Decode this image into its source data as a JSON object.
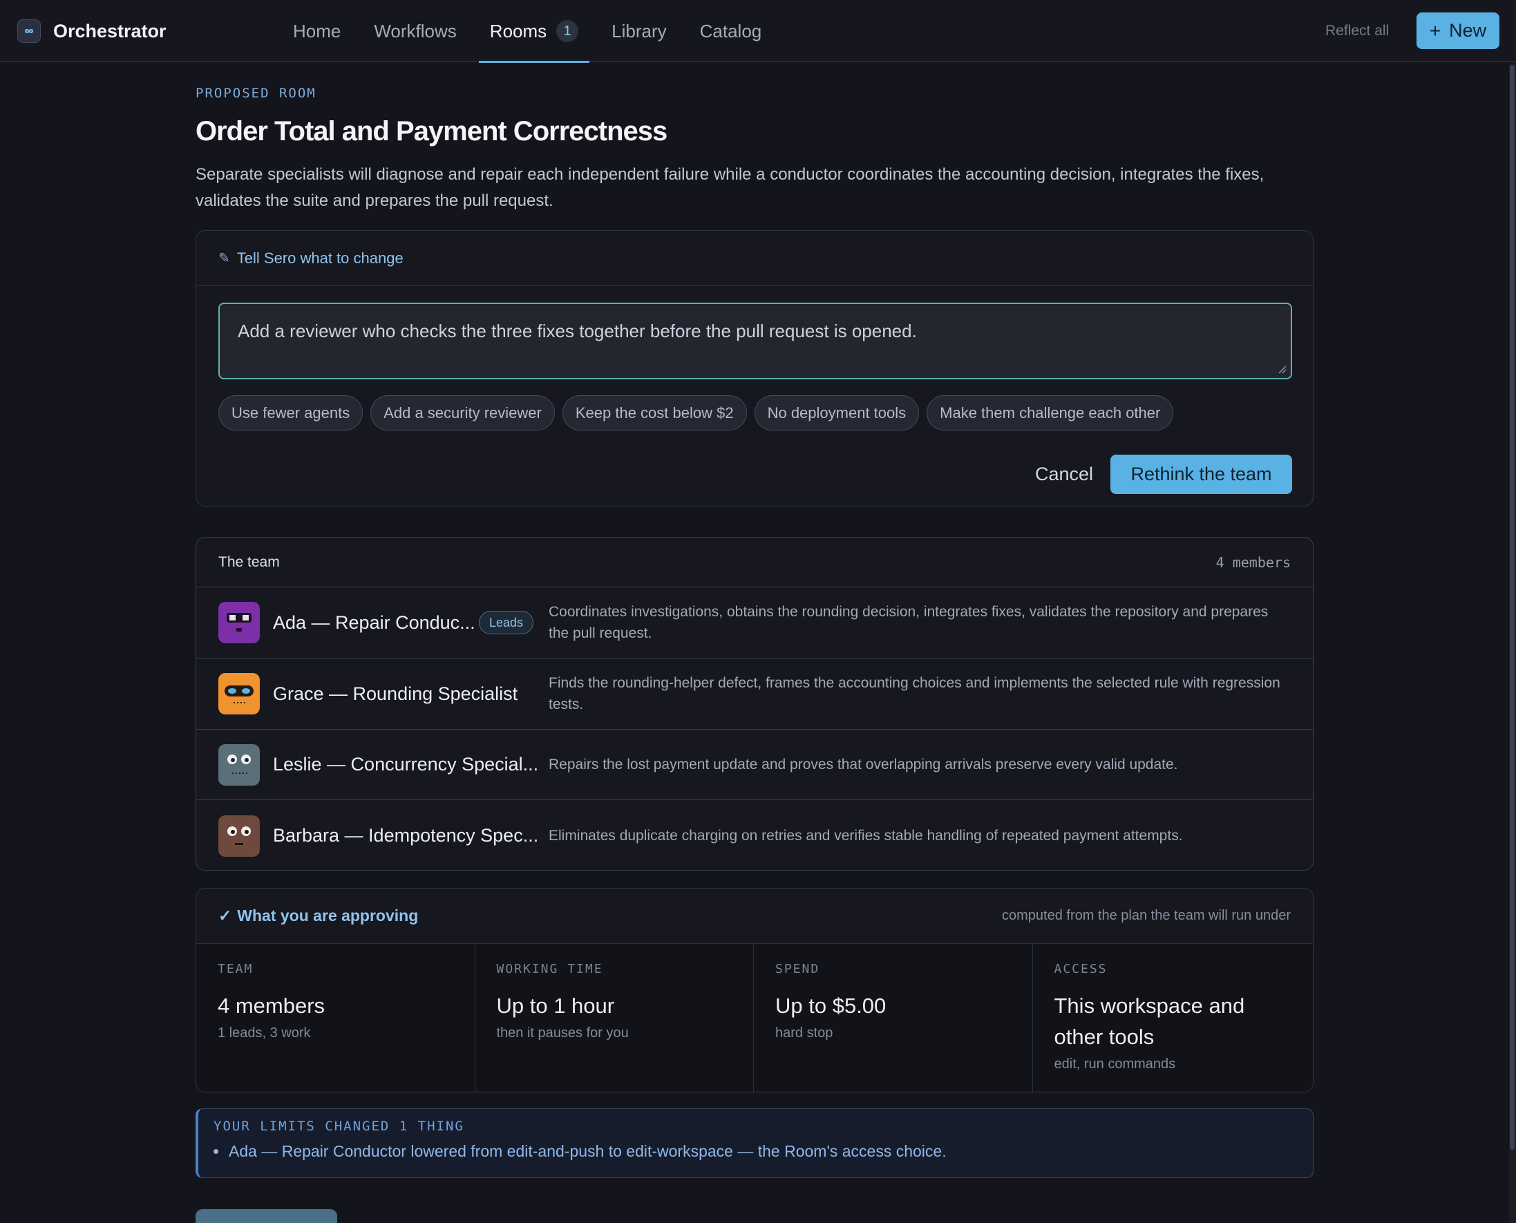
{
  "app": {
    "title": "Orchestrator",
    "logo_icon": "infinity-icon"
  },
  "nav": {
    "items": [
      {
        "label": "Home"
      },
      {
        "label": "Workflows"
      },
      {
        "label": "Rooms",
        "badge": "1",
        "active": true
      },
      {
        "label": "Library"
      },
      {
        "label": "Catalog"
      }
    ],
    "reflect_all": "Reflect all",
    "new_button": {
      "plus": "+",
      "label": "New"
    }
  },
  "room": {
    "eyebrow": "PROPOSED ROOM",
    "title": "Order Total and Payment Correctness",
    "description": "Separate specialists will diagnose and repair each independent failure while a conductor coordinates the accounting decision, integrates the fixes, validates the suite and prepares the pull request."
  },
  "change": {
    "heading": "Tell Sero what to change",
    "icon": "pencil-icon",
    "input_value": "Add a reviewer who checks the three fixes together before the pull request is opened.",
    "suggestions": [
      "Use fewer agents",
      "Add a security reviewer",
      "Keep the cost below $2",
      "No deployment tools",
      "Make them challenge each other"
    ],
    "cancel_label": "Cancel",
    "rethink_label": "Rethink the team"
  },
  "team": {
    "heading": "The team",
    "count": "4 members",
    "members": [
      {
        "name": "Ada — Repair Conduc...",
        "badge": "Leads",
        "description": "Coordinates investigations, obtains the rounding decision, integrates fixes, validates the repository and prepares the pull request.",
        "avatar_color": "#7d2fa8",
        "avatar": "robot-avatar-purple"
      },
      {
        "name": "Grace — Rounding Specialist",
        "description": "Finds the rounding-helper defect, frames the accounting choices and implements the selected rule with regression tests.",
        "avatar_color": "#f0922e",
        "avatar": "robot-avatar-orange"
      },
      {
        "name": "Leslie — Concurrency Special...",
        "description": "Repairs the lost payment update and proves that overlapping arrivals preserve every valid update.",
        "avatar_color": "#5c6e78",
        "avatar": "robot-avatar-slate"
      },
      {
        "name": "Barbara — Idempotency Spec...",
        "description": "Eliminates duplicate charging on retries and verifies stable handling of repeated payment attempts.",
        "avatar_color": "#6e4a3c",
        "avatar": "robot-avatar-brown"
      }
    ]
  },
  "approve": {
    "check": "✓",
    "heading": "What you are approving",
    "note": "computed from the plan the team will run under",
    "stats": [
      {
        "label": "TEAM",
        "value": "4 members",
        "sub": "1 leads, 3 work"
      },
      {
        "label": "WORKING TIME",
        "value": "Up to 1 hour",
        "sub": "then it pauses for you"
      },
      {
        "label": "SPEND",
        "value": "Up to $5.00",
        "sub": "hard stop"
      },
      {
        "label": "ACCESS",
        "value": "This workspace and other tools",
        "sub": "edit, run commands"
      }
    ]
  },
  "limits": {
    "heading": "YOUR LIMITS CHANGED 1 THING",
    "items": [
      "Ada — Repair Conductor lowered from edit-and-push to edit-workspace — the Room's access choice."
    ]
  },
  "colors": {
    "accent": "#5ab1e3",
    "background": "#14151c",
    "input_border": "#5bb3ad"
  }
}
